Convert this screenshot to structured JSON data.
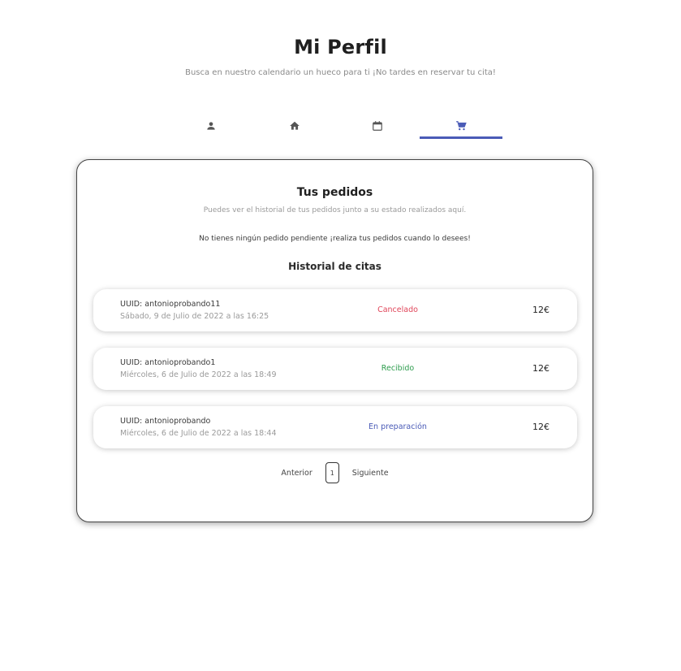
{
  "header": {
    "title": "Mi Perfil",
    "subtitle": "Busca en nuestro calendario un hueco para ti ¡No tardes en reservar tu cita!"
  },
  "tabs": [
    {
      "icon": "person-icon",
      "active": false
    },
    {
      "icon": "home-icon",
      "active": false
    },
    {
      "icon": "calendar-icon",
      "active": false
    },
    {
      "icon": "cart-icon",
      "active": true
    }
  ],
  "colors": {
    "accent": "#4a5bb7",
    "status_cancelled": "#e0465a",
    "status_received": "#2e9d4e",
    "status_preparing": "#4a5bb7"
  },
  "orders_panel": {
    "title": "Tus pedidos",
    "subtitle": "Puedes ver el historial de tus pedidos junto a su estado realizados aquí.",
    "pending_message": "No tienes ningún pedido pendiente ¡realiza tus pedidos cuando lo desees!",
    "history_title": "Historial de citas",
    "orders": [
      {
        "uuid": "UUID: antonioprobando11",
        "date": "Sábado, 9 de Julio de 2022 a las 16:25",
        "status": "Cancelado",
        "price": "12€"
      },
      {
        "uuid": "UUID: antonioprobando1",
        "date": "Miércoles, 6 de Julio de 2022 a las 18:49",
        "status": "Recibido",
        "price": "12€"
      },
      {
        "uuid": "UUID: antonioprobando",
        "date": "Miércoles, 6 de Julio de 2022 a las 18:44",
        "status": "En preparación",
        "price": "12€"
      }
    ],
    "pagination": {
      "prev_label": "Anterior",
      "page": "1",
      "next_label": "Siguiente"
    }
  }
}
